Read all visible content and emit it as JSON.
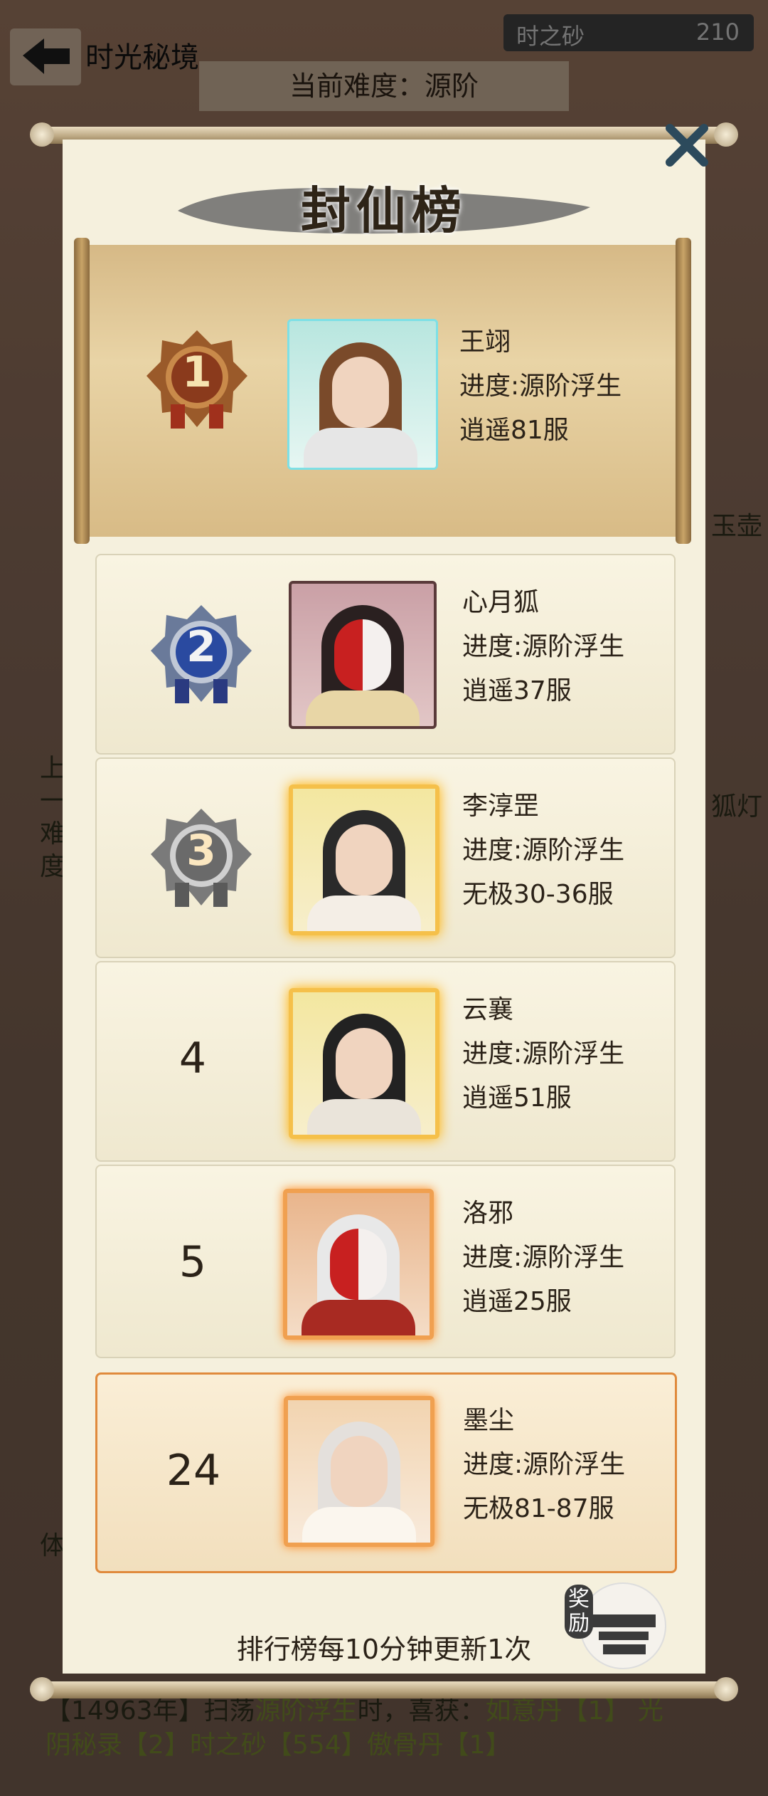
{
  "header": {
    "back_label": "返回",
    "title": "时光秘境",
    "currency_name": "时之砂",
    "currency_value": "210",
    "difficulty": "当前难度：源阶"
  },
  "background_side_labels": {
    "right_1": "玉壶",
    "right_2": "狐灯",
    "left_1": "上",
    "left_2": "一",
    "left_3": "难",
    "left_4": "度",
    "left_5": "体"
  },
  "background_log": {
    "line1_prefix": "【14963年】扫荡",
    "line1_highlight": "源阶浮生",
    "line1_mid": "时，喜获：",
    "line1_item": "如意丹【1】 光",
    "line2": "阴秘录【2】时之砂【554】傲骨丹【1】"
  },
  "modal": {
    "title": "封仙榜",
    "footer": "排行榜每10分钟更新1次",
    "reward_label": "奖励"
  },
  "rankings": [
    {
      "rank": "1",
      "name": "王翊",
      "progress": "进度:源阶浮生",
      "server": "逍遥81服"
    },
    {
      "rank": "2",
      "name": "心月狐",
      "progress": "进度:源阶浮生",
      "server": "逍遥37服"
    },
    {
      "rank": "3",
      "name": "李淳罡",
      "progress": "进度:源阶浮生",
      "server": "无极30-36服"
    },
    {
      "rank": "4",
      "name": "云襄",
      "progress": "进度:源阶浮生",
      "server": "逍遥51服"
    },
    {
      "rank": "5",
      "name": "洛邪",
      "progress": "进度:源阶浮生",
      "server": "逍遥25服"
    }
  ],
  "my_rank": {
    "rank": "24",
    "name": "墨尘",
    "progress": "进度:源阶浮生",
    "server": "无极81-87服"
  },
  "colors": {
    "accent_gold": "#e0a93c",
    "mine_border": "#e08a3c",
    "parchment": "#f5f0dd"
  }
}
